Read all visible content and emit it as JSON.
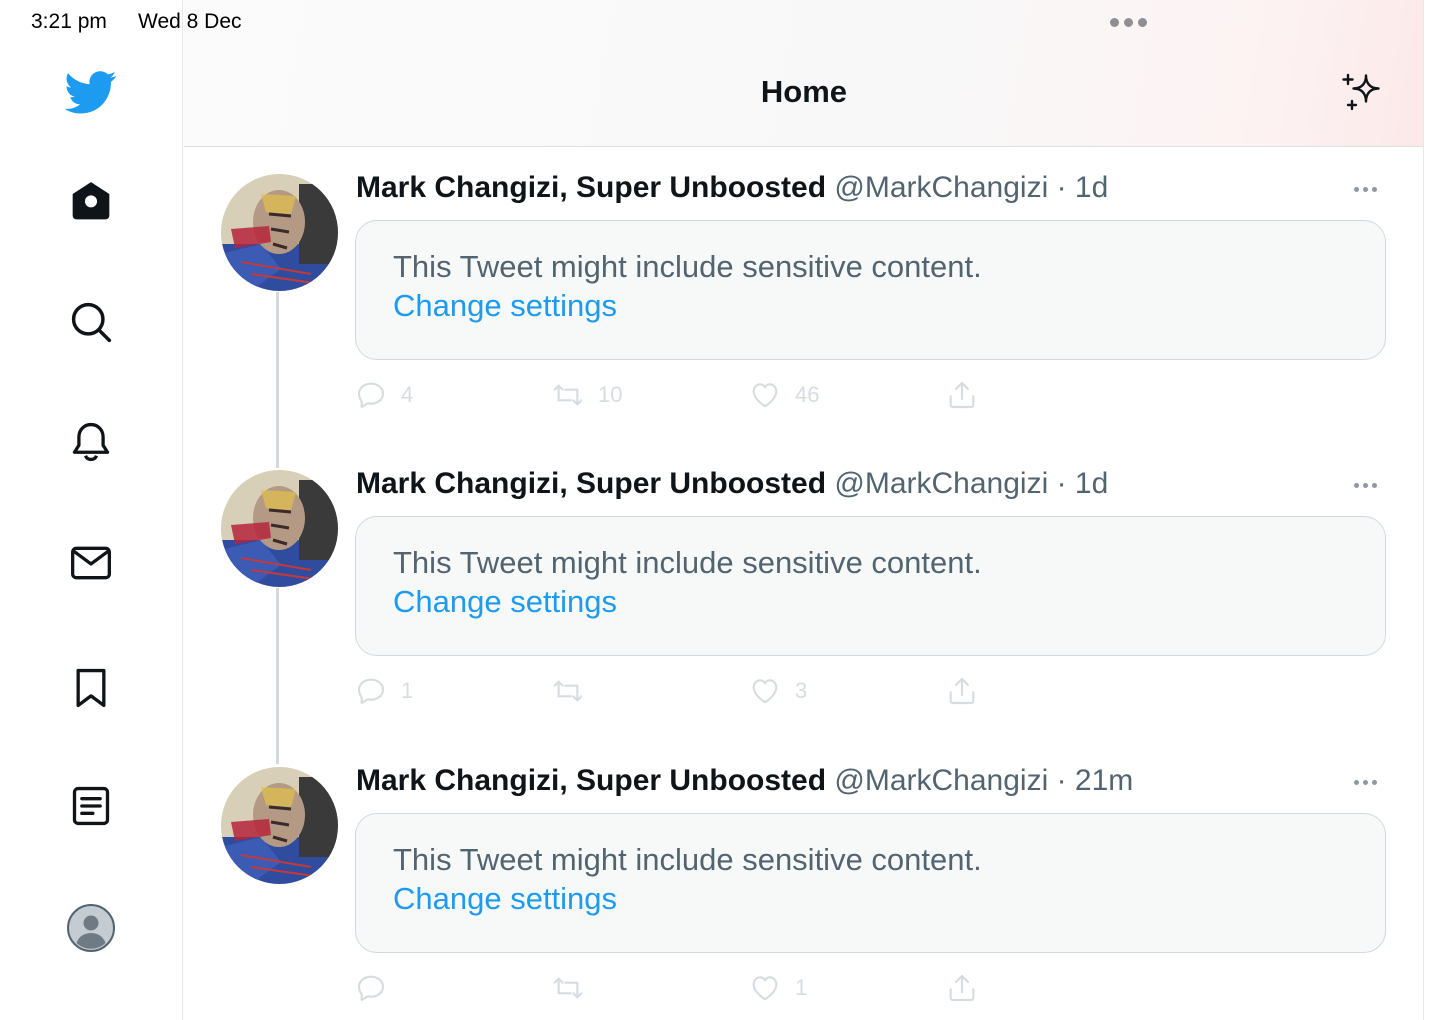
{
  "status_bar": {
    "time": "3:21 pm",
    "date": "Wed 8 Dec"
  },
  "header": {
    "title": "Home"
  },
  "colors": {
    "accent": "#1d9bf0",
    "text": "#0f1419",
    "secondary": "#536471"
  },
  "sidebar": {
    "items": [
      {
        "name": "twitter-logo",
        "icon": "bird-icon"
      },
      {
        "name": "home",
        "icon": "home-icon"
      },
      {
        "name": "explore",
        "icon": "search-icon"
      },
      {
        "name": "notifications",
        "icon": "bell-icon"
      },
      {
        "name": "messages",
        "icon": "mail-icon"
      },
      {
        "name": "bookmarks",
        "icon": "bookmark-icon"
      },
      {
        "name": "lists",
        "icon": "list-icon"
      },
      {
        "name": "profile",
        "icon": "avatar-icon"
      }
    ]
  },
  "tweets": [
    {
      "author": "Mark Changizi, Super Unboosted",
      "handle": "@MarkChangizi",
      "time": "· 1d",
      "notice": "This Tweet might include sensitive content.",
      "link": "Change settings",
      "replies": "4",
      "retweets": "10",
      "likes": "46"
    },
    {
      "author": "Mark Changizi, Super Unboosted",
      "handle": "@MarkChangizi",
      "time": "· 1d",
      "notice": "This Tweet might include sensitive content.",
      "link": "Change settings",
      "replies": "1",
      "retweets": "",
      "likes": "3"
    },
    {
      "author": "Mark Changizi, Super Unboosted",
      "handle": "@MarkChangizi",
      "time": "· 21m",
      "notice": "This Tweet might include sensitive content.",
      "link": "Change settings",
      "replies": "",
      "retweets": "",
      "likes": "1"
    }
  ]
}
